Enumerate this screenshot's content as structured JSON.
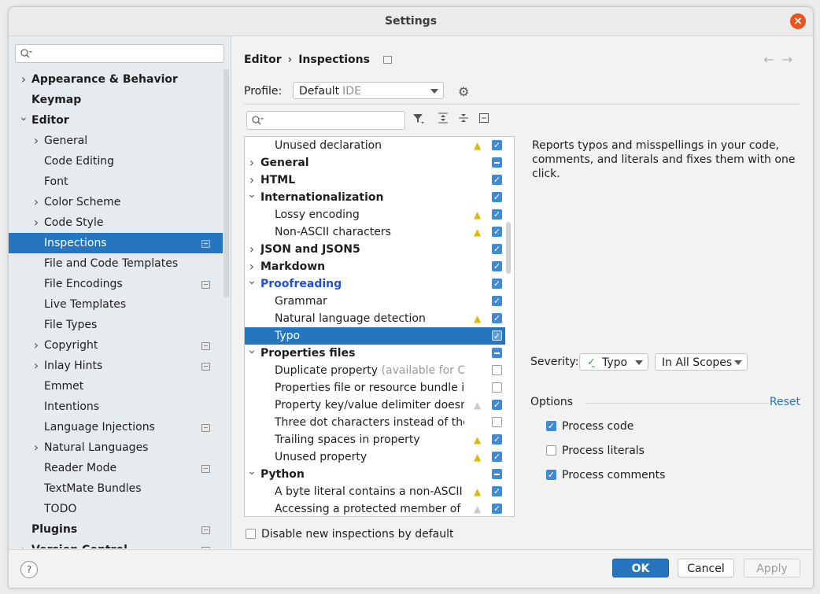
{
  "window": {
    "title": "Settings"
  },
  "sidebar": {
    "items": [
      {
        "label": "Appearance & Behavior",
        "level": 0,
        "arrow": "collapsed",
        "bold": true,
        "config": false,
        "selected": false
      },
      {
        "label": "Keymap",
        "level": 0,
        "arrow": "none",
        "bold": true,
        "config": false,
        "selected": false
      },
      {
        "label": "Editor",
        "level": 0,
        "arrow": "expanded",
        "bold": true,
        "config": false,
        "selected": false
      },
      {
        "label": "General",
        "level": 1,
        "arrow": "collapsed",
        "bold": false,
        "config": false,
        "selected": false
      },
      {
        "label": "Code Editing",
        "level": 1,
        "arrow": "none",
        "bold": false,
        "config": false,
        "selected": false
      },
      {
        "label": "Font",
        "level": 1,
        "arrow": "none",
        "bold": false,
        "config": false,
        "selected": false
      },
      {
        "label": "Color Scheme",
        "level": 1,
        "arrow": "collapsed",
        "bold": false,
        "config": false,
        "selected": false
      },
      {
        "label": "Code Style",
        "level": 1,
        "arrow": "collapsed",
        "bold": false,
        "config": false,
        "selected": false
      },
      {
        "label": "Inspections",
        "level": 1,
        "arrow": "none",
        "bold": false,
        "config": true,
        "selected": true
      },
      {
        "label": "File and Code Templates",
        "level": 1,
        "arrow": "none",
        "bold": false,
        "config": false,
        "selected": false
      },
      {
        "label": "File Encodings",
        "level": 1,
        "arrow": "none",
        "bold": false,
        "config": true,
        "selected": false
      },
      {
        "label": "Live Templates",
        "level": 1,
        "arrow": "none",
        "bold": false,
        "config": false,
        "selected": false
      },
      {
        "label": "File Types",
        "level": 1,
        "arrow": "none",
        "bold": false,
        "config": false,
        "selected": false
      },
      {
        "label": "Copyright",
        "level": 1,
        "arrow": "collapsed",
        "bold": false,
        "config": true,
        "selected": false
      },
      {
        "label": "Inlay Hints",
        "level": 1,
        "arrow": "collapsed",
        "bold": false,
        "config": true,
        "selected": false
      },
      {
        "label": "Emmet",
        "level": 1,
        "arrow": "none",
        "bold": false,
        "config": false,
        "selected": false
      },
      {
        "label": "Intentions",
        "level": 1,
        "arrow": "none",
        "bold": false,
        "config": false,
        "selected": false
      },
      {
        "label": "Language Injections",
        "level": 1,
        "arrow": "none",
        "bold": false,
        "config": true,
        "selected": false
      },
      {
        "label": "Natural Languages",
        "level": 1,
        "arrow": "collapsed",
        "bold": false,
        "config": false,
        "selected": false
      },
      {
        "label": "Reader Mode",
        "level": 1,
        "arrow": "none",
        "bold": false,
        "config": true,
        "selected": false
      },
      {
        "label": "TextMate Bundles",
        "level": 1,
        "arrow": "none",
        "bold": false,
        "config": false,
        "selected": false
      },
      {
        "label": "TODO",
        "level": 1,
        "arrow": "none",
        "bold": false,
        "config": false,
        "selected": false
      },
      {
        "label": "Plugins",
        "level": 0,
        "arrow": "none",
        "bold": true,
        "config": true,
        "selected": false
      },
      {
        "label": "Version Control",
        "level": 0,
        "arrow": "collapsed",
        "bold": true,
        "config": true,
        "selected": false
      }
    ]
  },
  "breadcrumb": {
    "part1": "Editor",
    "separator": "›",
    "part2": "Inspections"
  },
  "profile": {
    "label": "Profile:",
    "value": "Default",
    "suffix": "IDE"
  },
  "inspections": [
    {
      "label": "Unused declaration",
      "extra": "",
      "group": false,
      "arrow": "none",
      "warn": "yellow",
      "check": "on",
      "selected": false,
      "highlight": false
    },
    {
      "label": "General",
      "extra": "",
      "group": true,
      "arrow": "collapsed",
      "warn": "none",
      "check": "partial",
      "selected": false,
      "highlight": false
    },
    {
      "label": "HTML",
      "extra": "",
      "group": true,
      "arrow": "collapsed",
      "warn": "none",
      "check": "on",
      "selected": false,
      "highlight": false
    },
    {
      "label": "Internationalization",
      "extra": "",
      "group": true,
      "arrow": "expanded",
      "warn": "none",
      "check": "on",
      "selected": false,
      "highlight": false
    },
    {
      "label": "Lossy encoding",
      "extra": "",
      "group": false,
      "arrow": "none",
      "warn": "yellow",
      "check": "on",
      "selected": false,
      "highlight": false
    },
    {
      "label": "Non-ASCII characters",
      "extra": "",
      "group": false,
      "arrow": "none",
      "warn": "yellow",
      "check": "on",
      "selected": false,
      "highlight": false
    },
    {
      "label": "JSON and JSON5",
      "extra": "",
      "group": true,
      "arrow": "collapsed",
      "warn": "none",
      "check": "on",
      "selected": false,
      "highlight": false
    },
    {
      "label": "Markdown",
      "extra": "",
      "group": true,
      "arrow": "collapsed",
      "warn": "none",
      "check": "on",
      "selected": false,
      "highlight": false
    },
    {
      "label": "Proofreading",
      "extra": "",
      "group": true,
      "arrow": "expanded",
      "warn": "none",
      "check": "on",
      "selected": false,
      "highlight": true
    },
    {
      "label": "Grammar",
      "extra": "",
      "group": false,
      "arrow": "none",
      "warn": "none",
      "check": "on",
      "selected": false,
      "highlight": false
    },
    {
      "label": "Natural language detection",
      "extra": "",
      "group": false,
      "arrow": "none",
      "warn": "yellow",
      "check": "on",
      "selected": false,
      "highlight": false
    },
    {
      "label": "Typo",
      "extra": "",
      "group": false,
      "arrow": "none",
      "warn": "none",
      "check": "on",
      "selected": true,
      "highlight": false
    },
    {
      "label": "Properties files",
      "extra": "",
      "group": true,
      "arrow": "expanded",
      "warn": "none",
      "check": "partial",
      "selected": false,
      "highlight": false
    },
    {
      "label": "Duplicate property",
      "extra": "(available for Cod",
      "group": false,
      "arrow": "none",
      "warn": "none",
      "check": "off",
      "selected": false,
      "highlight": false
    },
    {
      "label": "Properties file or resource bundle is a",
      "extra": "",
      "group": false,
      "arrow": "none",
      "warn": "none",
      "check": "off",
      "selected": false,
      "highlight": false
    },
    {
      "label": "Property key/value delimiter doesn't",
      "extra": "",
      "group": false,
      "arrow": "none",
      "warn": "gray",
      "check": "on",
      "selected": false,
      "highlight": false
    },
    {
      "label": "Three dot characters instead of the el",
      "extra": "",
      "group": false,
      "arrow": "none",
      "warn": "none",
      "check": "off",
      "selected": false,
      "highlight": false
    },
    {
      "label": "Trailing spaces in property",
      "extra": "",
      "group": false,
      "arrow": "none",
      "warn": "yellow",
      "check": "on",
      "selected": false,
      "highlight": false
    },
    {
      "label": "Unused property",
      "extra": "",
      "group": false,
      "arrow": "none",
      "warn": "yellow",
      "check": "on",
      "selected": false,
      "highlight": false
    },
    {
      "label": "Python",
      "extra": "",
      "group": true,
      "arrow": "expanded",
      "warn": "none",
      "check": "partial",
      "selected": false,
      "highlight": false
    },
    {
      "label": "A byte literal contains a non-ASCII cha",
      "extra": "",
      "group": false,
      "arrow": "none",
      "warn": "yellow",
      "check": "on",
      "selected": false,
      "highlight": false
    },
    {
      "label": "Accessing a protected member of a cl",
      "extra": "",
      "group": false,
      "arrow": "none",
      "warn": "gray",
      "check": "on",
      "selected": false,
      "highlight": false
    }
  ],
  "disable_new": {
    "label": "Disable new inspections by default",
    "checked": false
  },
  "description": "Reports typos and misspellings in your code, comments, and literals and fixes them with one click.",
  "severity": {
    "label": "Severity:",
    "value": "Typo",
    "scope": "In All Scopes"
  },
  "options": {
    "label": "Options",
    "reset": "Reset",
    "items": [
      {
        "label": "Process code",
        "checked": true
      },
      {
        "label": "Process literals",
        "checked": false
      },
      {
        "label": "Process comments",
        "checked": true
      }
    ]
  },
  "footer": {
    "help": "?",
    "ok": "OK",
    "cancel": "Cancel",
    "apply": "Apply"
  },
  "colors": {
    "accent": "#2675bf",
    "close": "#e95420",
    "warning": "#e0b800",
    "link": "#2675bf",
    "highlight": "#1e4fd6"
  }
}
